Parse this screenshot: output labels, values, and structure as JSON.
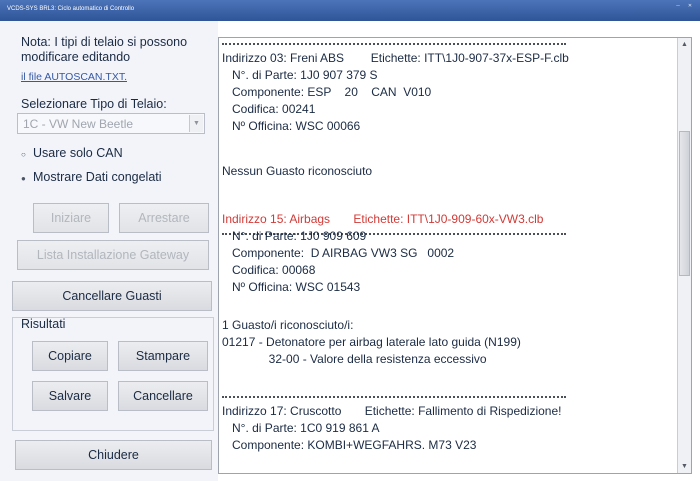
{
  "window": {
    "title": "VCDS-SYS BRL3: Ciclo automatico di Controllo"
  },
  "left_panel": {
    "note_lines": [
      "Nota:  I tipi di telaio si possono",
      "modificare editando"
    ],
    "note_link": "il file AUTOSCAN.TXT.",
    "select_label": "Selezionare Tipo di Telaio:",
    "chassis_value": "1C - VW New Beetle",
    "option_can": "Usare solo CAN",
    "option_freeze": "Mostrare Dati congelati",
    "start_label": "Iniziare",
    "stop_label": "Arrestare",
    "gateway_label": "Lista Installazione Gateway",
    "clear_faults_label": "Cancellare Guasti",
    "results_label": "Risultati",
    "copy_label": "Copiare",
    "print_label": "Stampare",
    "save_label": "Salvare",
    "delete_label": "Cancellare",
    "close_label": "Chiudere"
  },
  "log": {
    "lines": [
      {
        "text": "Indirizzo 03: Freni ABS        Etichette: ITT\\1J0-907-37x-ESP-F.clb",
        "color": ""
      },
      {
        "text": "   N°. di Parte: 1J0 907 379 S",
        "color": ""
      },
      {
        "text": "   Componente: ESP    20    CAN  V010",
        "color": ""
      },
      {
        "text": "   Codifica: 00241",
        "color": ""
      },
      {
        "text": "   Nº Officina: WSC 00066",
        "color": ""
      },
      {
        "text": "Nessun Guasto riconosciuto",
        "color": ""
      },
      {
        "text": "Indirizzo 15: Airbags       Etichette: ITT\\1J0-909-60x-VW3.clb",
        "color": "red"
      },
      {
        "text": "   N°. di Parte: 1J0 909 609",
        "color": ""
      },
      {
        "text": "   Componente:  D AIRBAG VW3 SG   0002",
        "color": ""
      },
      {
        "text": "   Codifica: 00068",
        "color": ""
      },
      {
        "text": "   Nº Officina: WSC 01543",
        "color": ""
      },
      {
        "text": "1 Guasto/i riconosciuto/i:",
        "color": ""
      },
      {
        "text": "01217 - Detonatore per airbag laterale lato guida (N199)",
        "color": ""
      },
      {
        "text": "              32-00 - Valore della resistenza eccessivo",
        "color": ""
      },
      {
        "text": "Indirizzo 17: Cruscotto       Etichette: Fallimento di Rispedizione!",
        "color": ""
      },
      {
        "text": "   N°. di Parte: 1C0 919 861 A",
        "color": ""
      },
      {
        "text": "   Componente: KOMBI+WEGFAHRS. M73 V23",
        "color": ""
      }
    ]
  }
}
